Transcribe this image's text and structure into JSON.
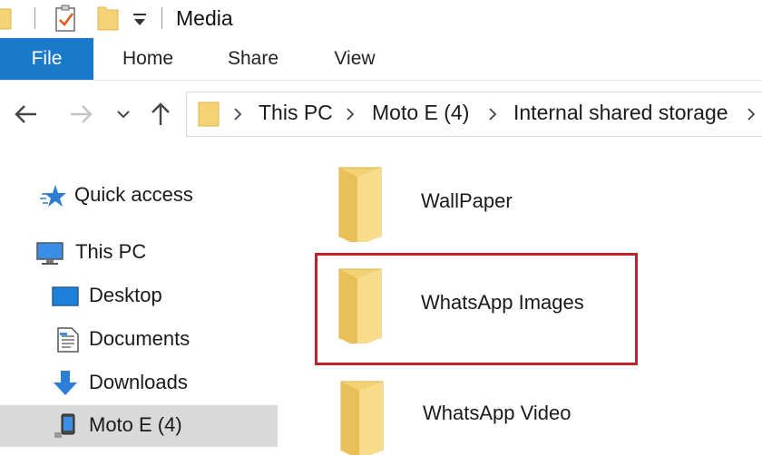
{
  "window": {
    "title": "Media"
  },
  "ribbon": {
    "tabs": [
      {
        "label": "File",
        "active": true
      },
      {
        "label": "Home",
        "active": false
      },
      {
        "label": "Share",
        "active": false
      },
      {
        "label": "View",
        "active": false
      }
    ]
  },
  "address": {
    "breadcrumbs": [
      "This PC",
      "Moto E (4)",
      "Internal shared storage"
    ]
  },
  "nav_pane": {
    "items": [
      {
        "label": "Quick access",
        "icon": "star-icon"
      },
      {
        "label": "This PC",
        "icon": "monitor-icon"
      },
      {
        "label": "Desktop",
        "icon": "desktop-icon"
      },
      {
        "label": "Documents",
        "icon": "documents-icon"
      },
      {
        "label": "Downloads",
        "icon": "downloads-icon"
      },
      {
        "label": "Moto E (4)",
        "icon": "phone-icon",
        "selected": true
      }
    ]
  },
  "content": {
    "folders": [
      {
        "name": "WallPaper",
        "highlighted": false
      },
      {
        "name": "WhatsApp Images",
        "highlighted": true
      },
      {
        "name": "WhatsApp Video",
        "highlighted": false
      }
    ]
  },
  "colors": {
    "accent": "#1979ca",
    "folder": "#f5d274",
    "highlight": "#c0212b",
    "selection": "#d9d9d9"
  }
}
